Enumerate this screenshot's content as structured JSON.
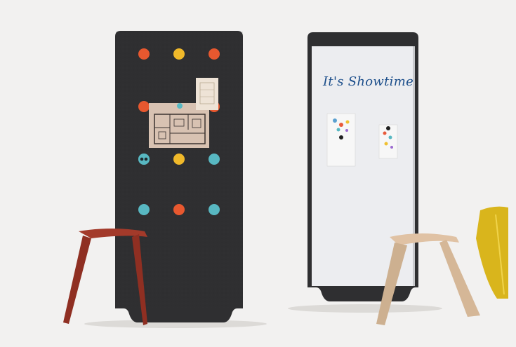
{
  "scene": {
    "background": "#f2f1f0",
    "felt_color": "#2f2f31",
    "dot_colors": {
      "orange": "#e8582f",
      "yellow": "#f0b92a",
      "teal": "#58b8c2"
    },
    "stool_left_color": "#a33a2a",
    "stool_right_color": "#e0c2a4",
    "stool_far_right_color": "#d9b51c"
  },
  "whiteboard": {
    "text": "It's Showtime"
  },
  "felt_dots": [
    [
      "orange",
      "yellow",
      "orange"
    ],
    [
      "orange",
      "",
      "orange"
    ],
    [
      "teal",
      "yellow",
      "teal"
    ],
    [
      "teal",
      "orange",
      "teal"
    ]
  ]
}
